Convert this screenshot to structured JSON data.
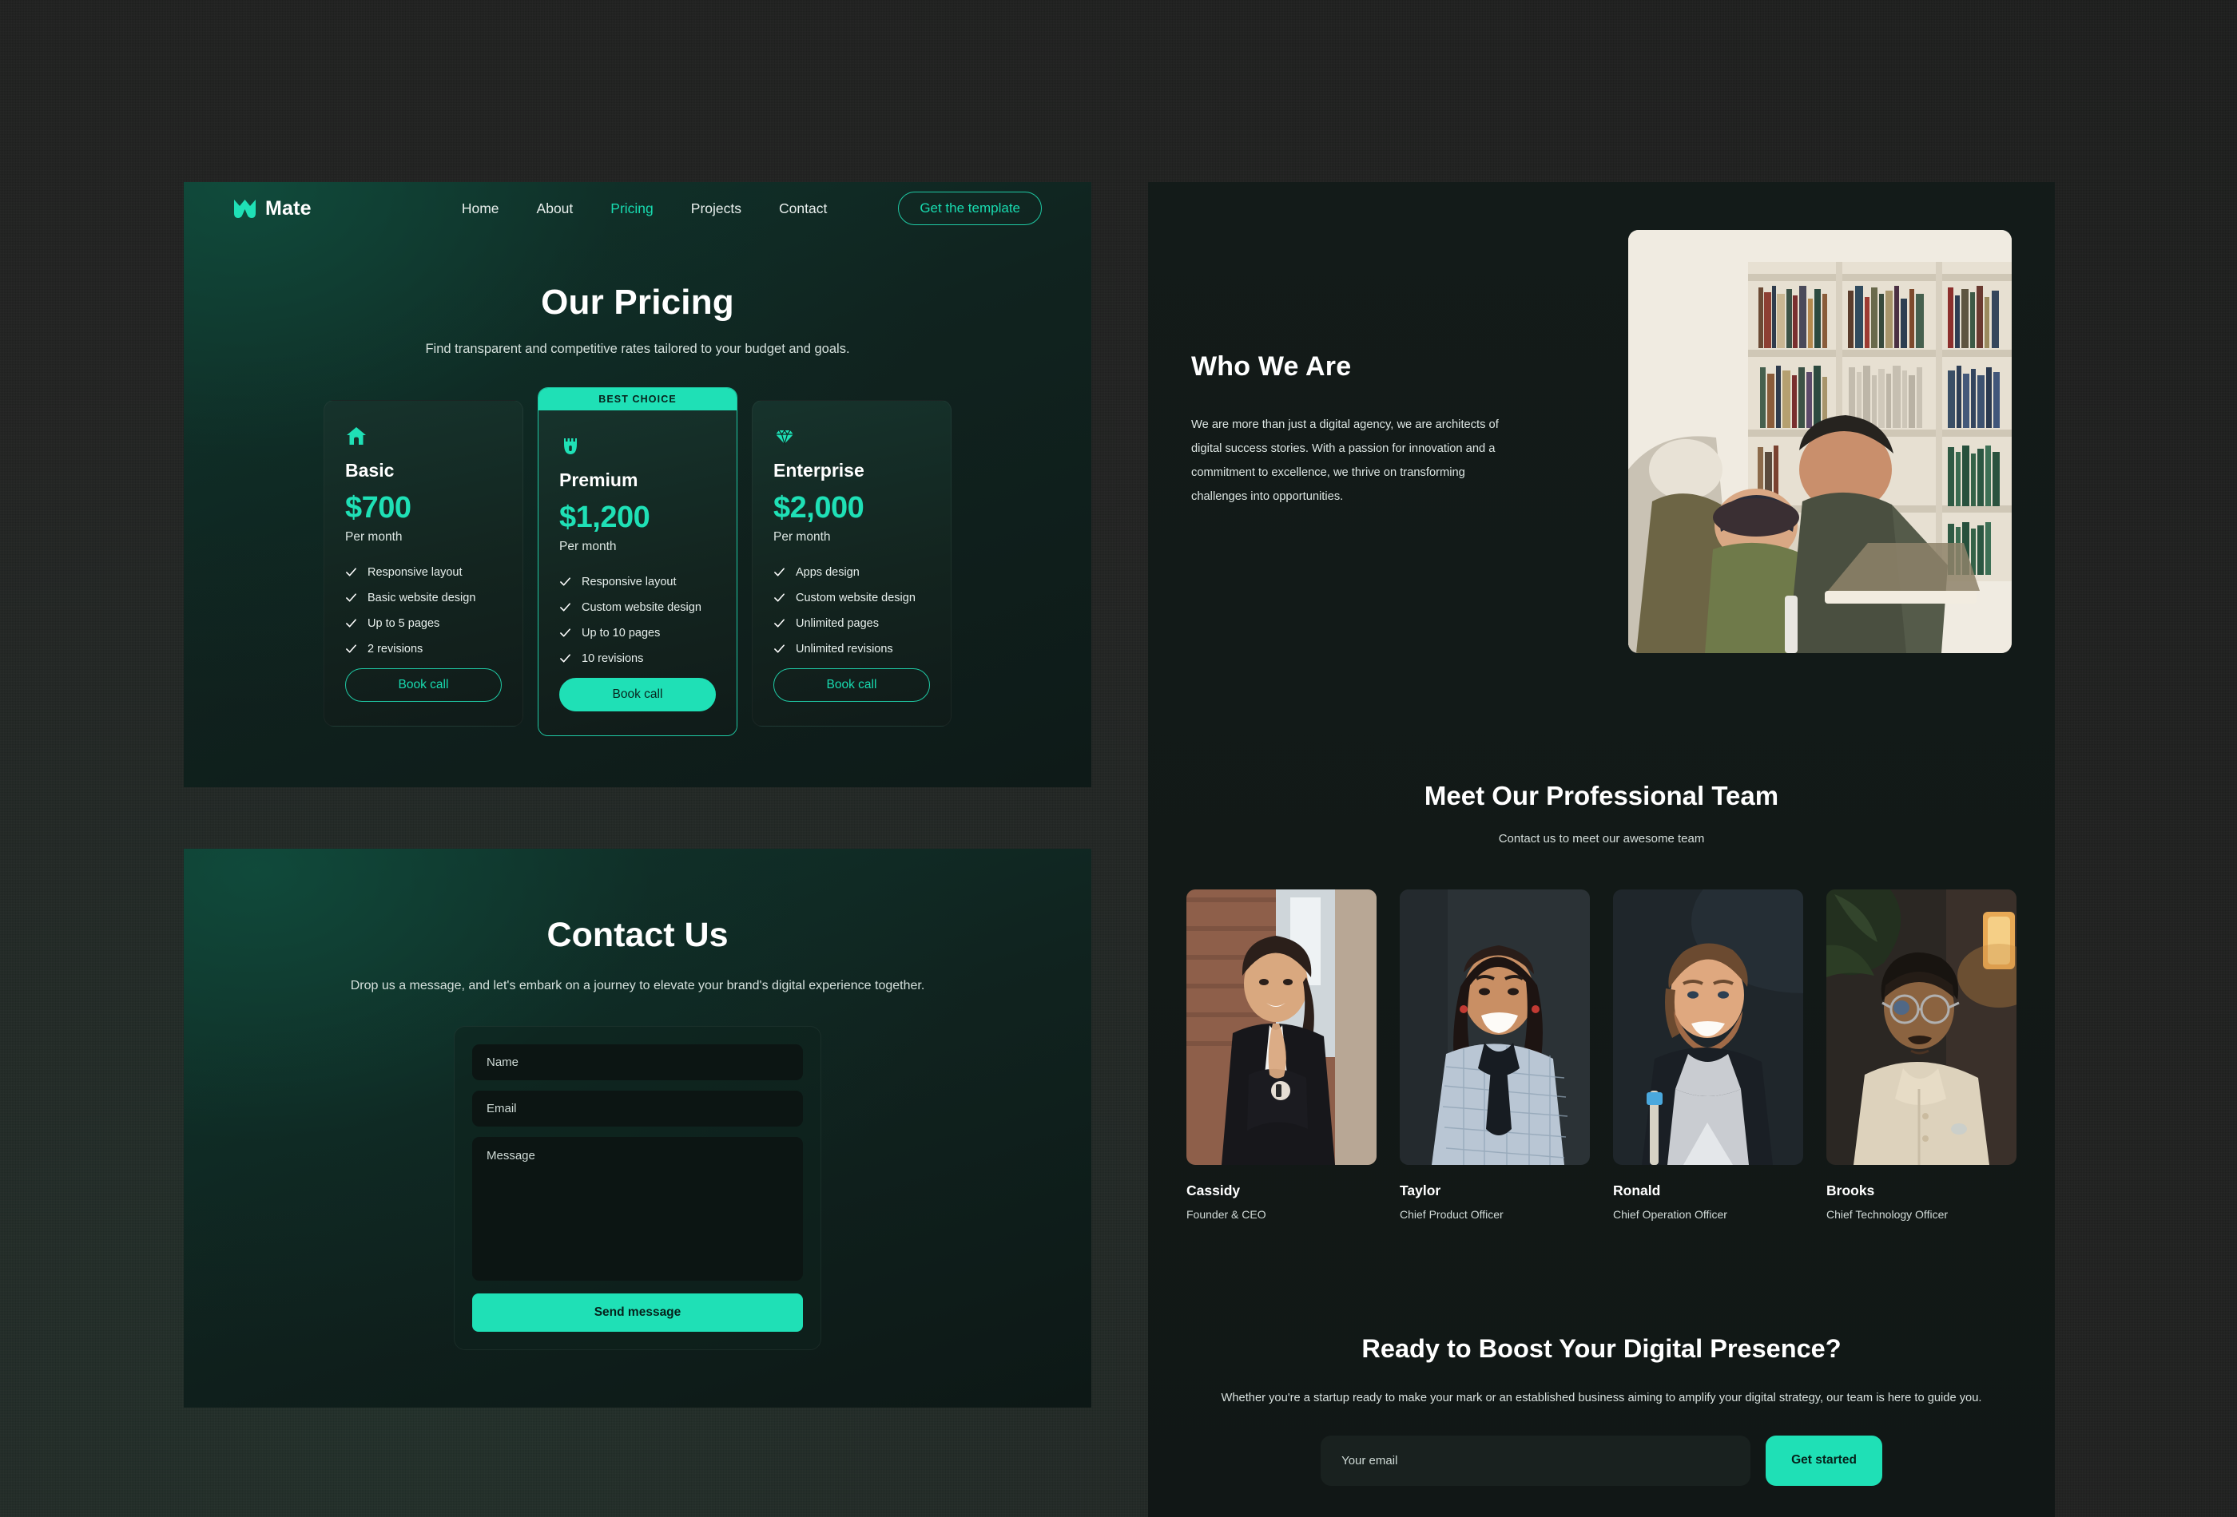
{
  "brand": {
    "name": "Mate",
    "logo_icon": "mate-chevron-logo",
    "accent": "#1fe0b6",
    "accent_dim": "#18dbb0"
  },
  "nav": {
    "links": [
      {
        "label": "Home",
        "active": false
      },
      {
        "label": "About",
        "active": false
      },
      {
        "label": "Pricing",
        "active": true
      },
      {
        "label": "Projects",
        "active": false
      },
      {
        "label": "Contact",
        "active": false
      }
    ],
    "cta_label": "Get the template"
  },
  "pricing": {
    "title": "Our Pricing",
    "subtitle": "Find transparent and competitive rates tailored to your budget and goals.",
    "best_badge": "BEST CHOICE",
    "plans": [
      {
        "icon": "home-icon",
        "name": "Basic",
        "price": "$700",
        "period": "Per month",
        "features": [
          "Responsive layout",
          "Basic website design",
          "Up to 5 pages",
          "2 revisions"
        ],
        "button_label": "Book call",
        "featured": false
      },
      {
        "icon": "castle-icon",
        "name": "Premium",
        "price": "$1,200",
        "period": "Per month",
        "features": [
          "Responsive layout",
          "Custom website design",
          "Up to 10 pages",
          "10 revisions"
        ],
        "button_label": "Book call",
        "featured": true
      },
      {
        "icon": "diamond-icon",
        "name": "Enterprise",
        "price": "$2,000",
        "period": "Per month",
        "features": [
          "Apps design",
          "Custom website design",
          "Unlimited pages",
          "Unlimited revisions"
        ],
        "button_label": "Book call",
        "featured": false
      }
    ]
  },
  "contact": {
    "title": "Contact Us",
    "subtitle": "Drop us a message, and let's embark on a journey to elevate your brand's digital experience together.",
    "fields": {
      "name_placeholder": "Name",
      "email_placeholder": "Email",
      "message_placeholder": "Message"
    },
    "submit_label": "Send message"
  },
  "about": {
    "title": "Who We Are",
    "body": "We are more than just a digital agency, we are architects of digital success stories. With a passion for innovation and a commitment to excellence, we thrive on transforming challenges into opportunities.",
    "photo_alt": "team-collaborating-in-library"
  },
  "team": {
    "title": "Meet Our Professional Team",
    "subtitle": "Contact us to meet our awesome team",
    "members": [
      {
        "name": "Cassidy",
        "role": "Founder & CEO",
        "photo_alt": "portrait-woman-blazer-brick-wall"
      },
      {
        "name": "Taylor",
        "role": "Chief Product Officer",
        "photo_alt": "portrait-woman-smiling-dark-background"
      },
      {
        "name": "Ronald",
        "role": "Chief Operation Officer",
        "photo_alt": "portrait-man-beard-dark-background"
      },
      {
        "name": "Brooks",
        "role": "Chief Technology Officer",
        "photo_alt": "portrait-man-glasses-warm-lamp"
      }
    ]
  },
  "cta": {
    "title": "Ready to Boost Your Digital Presence?",
    "subtitle": "Whether you're a startup ready to make your mark or an established business aiming to amplify your digital strategy, our team is here to guide you.",
    "email_placeholder": "Your email",
    "button_label": "Get started"
  }
}
